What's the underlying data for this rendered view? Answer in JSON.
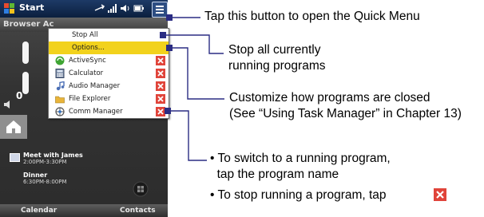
{
  "phone": {
    "statusbar": {
      "start_label": "Start"
    },
    "tabbar": {
      "tab_label": "Browser Ac"
    },
    "today": {
      "volume_value": "0",
      "appointments": [
        {
          "title": "Meet with James",
          "time": "2:00PM-3:30PM"
        },
        {
          "title": "Dinner",
          "time": "6:30PM-8:00PM"
        }
      ]
    },
    "softkeys": {
      "left": "Calendar",
      "right": "Contacts"
    }
  },
  "quick_menu": {
    "stop_all": "Stop All",
    "options": "Options...",
    "programs": [
      {
        "label": "ActiveSync",
        "icon": "activesync-icon"
      },
      {
        "label": "Calculator",
        "icon": "calculator-icon"
      },
      {
        "label": "Audio Manager",
        "icon": "audio-manager-icon"
      },
      {
        "label": "File Explorer",
        "icon": "file-explorer-icon"
      },
      {
        "label": "Comm Manager",
        "icon": "comm-manager-icon"
      }
    ],
    "close_icon": "close-x-icon"
  },
  "callouts": {
    "quick_menu": "Tap this button to open the Quick Menu",
    "stop_all": [
      "Stop all currently",
      "running programs"
    ],
    "options": [
      "Customize how programs are closed",
      "(See “Using Task Manager” in Chapter 13)"
    ],
    "switch_program": [
      "• To switch to a running program,",
      "  tap the program name"
    ],
    "stop_program": "• To stop running a program, tap"
  },
  "colors": {
    "leader_line": "#2b2d83",
    "highlight": "#f2d21c",
    "close_button": "#e0443a",
    "statusbar": "#0b1f3e"
  }
}
